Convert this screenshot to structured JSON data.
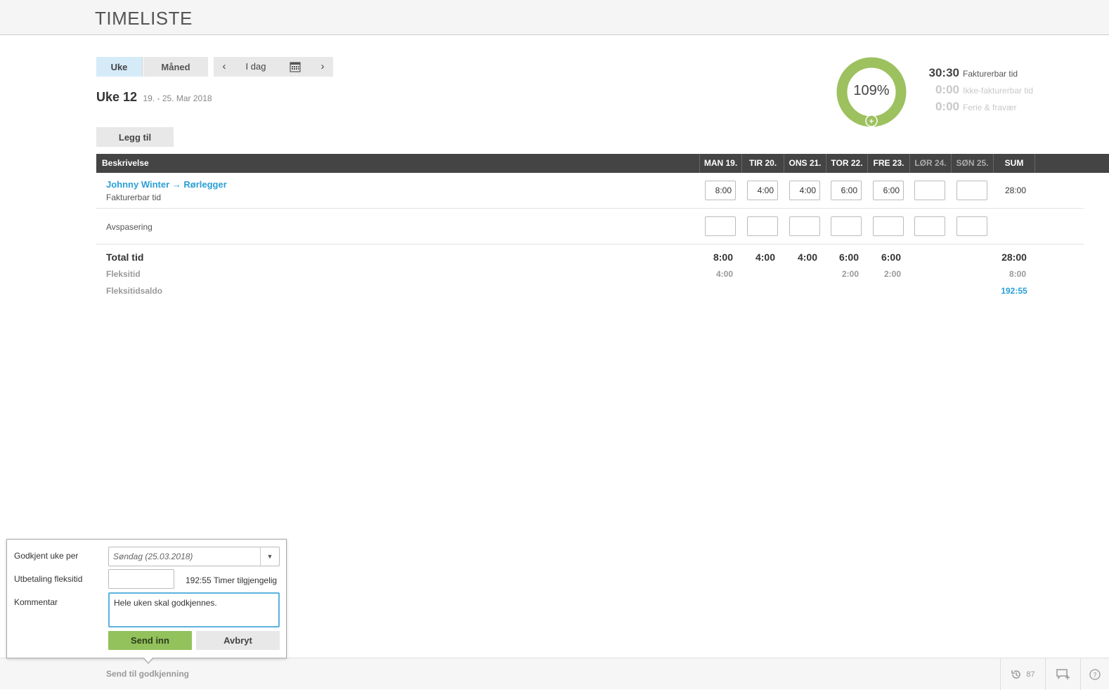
{
  "header": {
    "title": "TIMELISTE"
  },
  "view": {
    "week_label": "Uke",
    "month_label": "Måned"
  },
  "nav": {
    "prev": "‹",
    "today": "I dag",
    "next": "›",
    "calendar_icon": "calendar-icon"
  },
  "week": {
    "title": "Uke 12",
    "range": "19. - 25. Mar 2018"
  },
  "add_button": "Legg til",
  "summary": {
    "percent": "109%",
    "percent_value": 1.09,
    "color": "#9cc15e",
    "billable_value": "30:30",
    "billable_label": "Fakturerbar tid",
    "nonbillable_value": "0:00",
    "nonbillable_label": "Ikke-fakturerbar tid",
    "absence_value": "0:00",
    "absence_label": "Ferie & fravær"
  },
  "table": {
    "headers": {
      "desc": "Beskrivelse",
      "days": [
        "MAN 19.",
        "TIR 20.",
        "ONS 21.",
        "TOR 22.",
        "FRE 23.",
        "LØR 24.",
        "SØN 25."
      ],
      "sum": "SUM"
    },
    "rows": [
      {
        "project": "Johnny Winter → Rørlegger",
        "type": "Fakturerbar tid",
        "values": [
          "8:00",
          "4:00",
          "4:00",
          "6:00",
          "6:00",
          "",
          ""
        ],
        "sum": "28:00"
      },
      {
        "label": "Avspasering",
        "values": [
          "",
          "",
          "",
          "",
          "",
          "",
          ""
        ]
      }
    ],
    "totals": {
      "total_label": "Total tid",
      "total_values": [
        "8:00",
        "4:00",
        "4:00",
        "6:00",
        "6:00",
        "",
        ""
      ],
      "total_sum": "28:00",
      "flex_label": "Fleksitid",
      "flex_values": [
        "4:00",
        "",
        "",
        "2:00",
        "2:00",
        "",
        ""
      ],
      "flex_sum": "8:00",
      "balance_label": "Fleksitidsaldo",
      "balance": "192:55"
    }
  },
  "popup": {
    "approve_label": "Godkjent uke per",
    "approve_value": "Søndag (25.03.2018)",
    "payout_label": "Utbetaling fleksitid",
    "payout_value": "",
    "available_value": "192:55",
    "available_label": "Timer tilgjengelig",
    "comment_label": "Kommentar",
    "comment": "Hele uken skal godkjennes.",
    "submit": "Send inn",
    "cancel": "Avbryt"
  },
  "footer": {
    "send": "Send til godkjenning",
    "history_count": "87"
  }
}
